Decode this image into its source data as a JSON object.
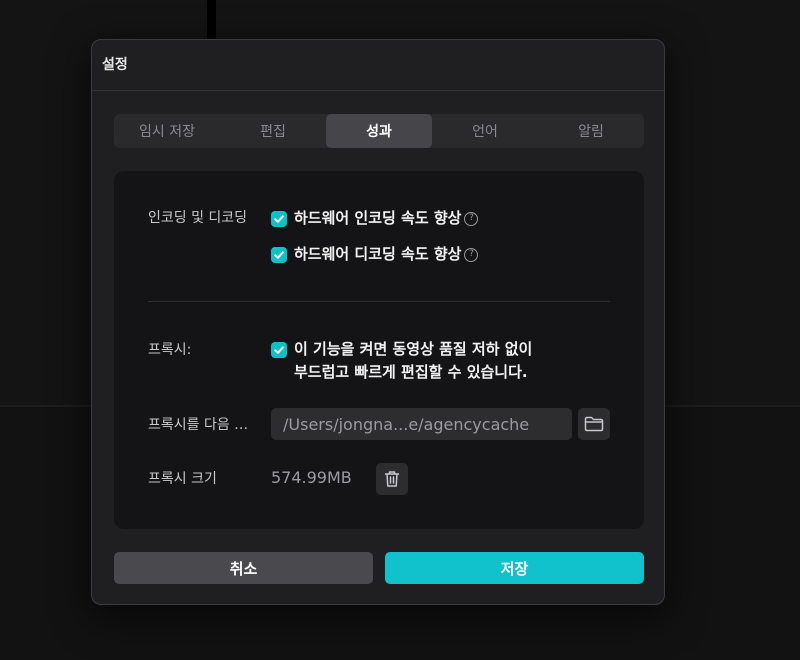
{
  "dialog": {
    "title": "설정",
    "tabs": [
      {
        "label": "임시 저장",
        "active": false
      },
      {
        "label": "편집",
        "active": false
      },
      {
        "label": "성과",
        "active": true
      },
      {
        "label": "언어",
        "active": false
      },
      {
        "label": "알림",
        "active": false
      }
    ],
    "encoding": {
      "label": "인코딩 및 디코딩",
      "hw_encoding": {
        "label": "하드웨어 인코딩 속도 향상",
        "checked": true,
        "help": "?"
      },
      "hw_decoding": {
        "label": "하드웨어 디코딩 속도 향상",
        "checked": true,
        "help": "?"
      }
    },
    "proxy": {
      "label": "프록시:",
      "checked": true,
      "description_line1": "이 기능을 켜면 동영상 품질 저하 없이",
      "description_line2": "부드럽고 빠르게 편집할 수 있습니다.",
      "location_label": "프록시를 다음 …",
      "location_path": "/Users/jongna...e/agencycache",
      "folder_icon": "folder-icon",
      "size_label": "프록시 크기",
      "size_value": "574.99MB",
      "delete_icon": "trash-icon"
    },
    "buttons": {
      "cancel": "취소",
      "save": "저장"
    },
    "colors": {
      "accent": "#11c2cc",
      "background": "#1f1f21",
      "panel": "#141416"
    }
  }
}
